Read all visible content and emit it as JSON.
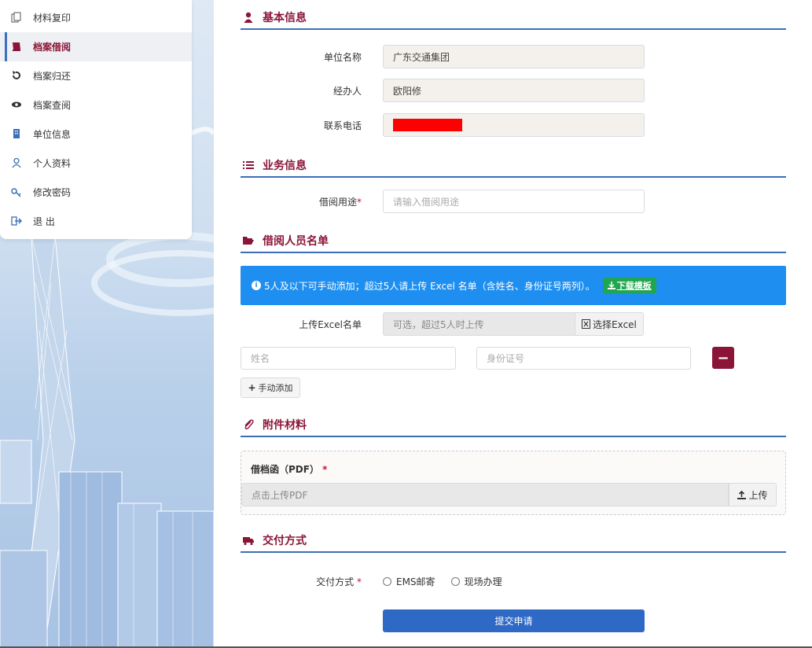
{
  "sidebar": {
    "items": [
      {
        "label": "材料复印",
        "icon": "copy-icon",
        "active": false
      },
      {
        "label": "档案借阅",
        "icon": "book-icon",
        "active": true
      },
      {
        "label": "档案归还",
        "icon": "return-icon",
        "active": false
      },
      {
        "label": "档案查阅",
        "icon": "eye-icon",
        "active": false
      },
      {
        "label": "单位信息",
        "icon": "building-icon",
        "active": false
      },
      {
        "label": "个人资料",
        "icon": "user-icon",
        "active": false
      },
      {
        "label": "修改密码",
        "icon": "key-icon",
        "active": false
      },
      {
        "label": "退 出",
        "icon": "logout-icon",
        "active": false
      }
    ]
  },
  "basic": {
    "title": "基本信息",
    "unit_label": "单位名称",
    "unit_value": "广东交通集团",
    "agent_label": "经办人",
    "agent_value": "欧阳修",
    "phone_label": "联系电话"
  },
  "business": {
    "title": "业务信息",
    "purpose_label": "借阅用途",
    "purpose_required": "*",
    "purpose_placeholder": "请输入借阅用途"
  },
  "people": {
    "title": "借阅人员名单",
    "notice": "5人及以下可手动添加；超过5人请上传 Excel 名单（含姓名、身份证号两列）。",
    "download_label": "下载模板",
    "excel_label": "上传Excel名单",
    "excel_placeholder": "可选，超过5人时上传",
    "excel_button": "选择Excel",
    "name_placeholder": "姓名",
    "id_placeholder": "身份证号",
    "remove_button": "−",
    "add_button": "手动添加"
  },
  "attachment": {
    "title": "附件材料",
    "doc_label": "借档函（PDF）",
    "doc_required": "*",
    "upload_placeholder": "点击上传PDF",
    "upload_button": "上传"
  },
  "delivery": {
    "title": "交付方式",
    "label": "交付方式",
    "required": "*",
    "options": [
      "EMS邮寄",
      "现场办理"
    ]
  },
  "submit_label": "提交申请",
  "colors": {
    "accent": "#8b1538",
    "primary": "#2f69c6",
    "notice": "#1e8ff0",
    "success": "#1fa64f"
  }
}
